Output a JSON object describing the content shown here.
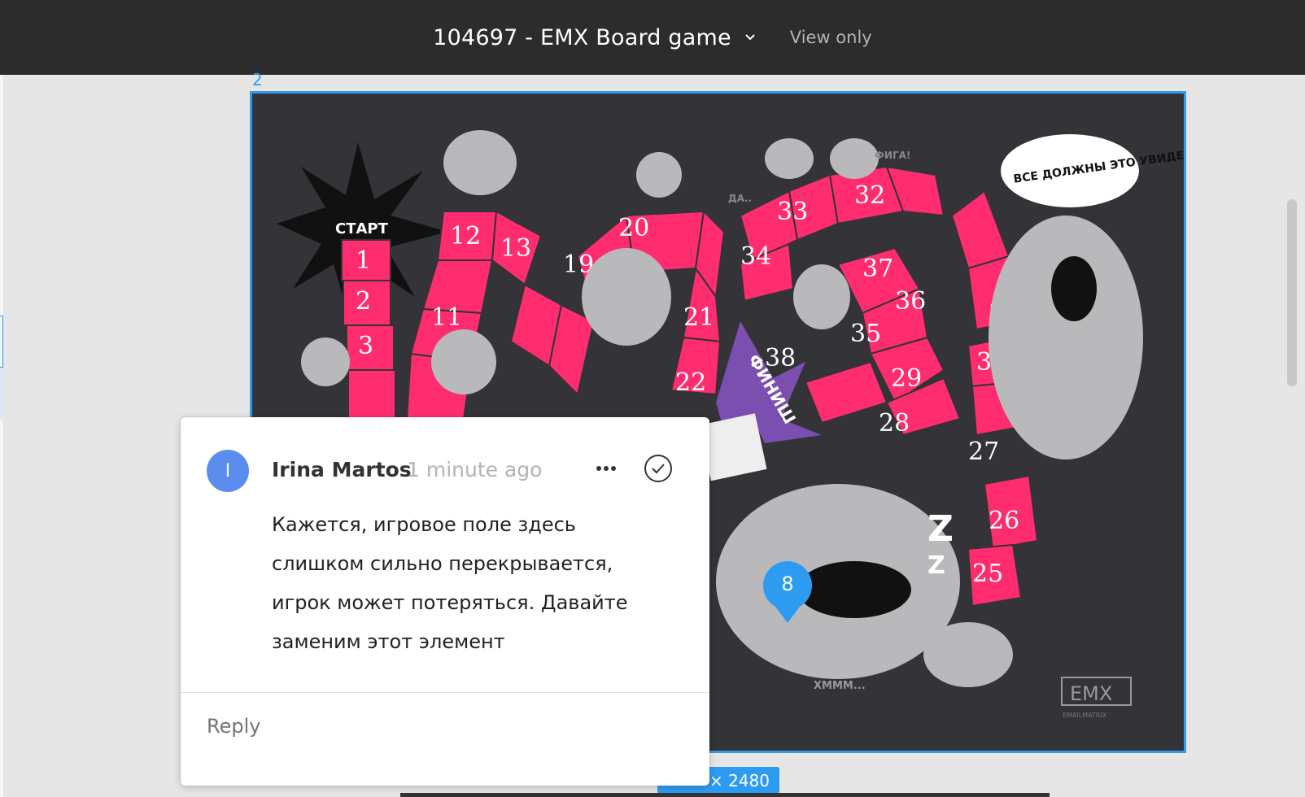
{
  "header": {
    "title": "104697 - EMX Board game",
    "view_mode": "View only"
  },
  "frame": {
    "label": "2",
    "size_label": "× 2480"
  },
  "board": {
    "start_label": "СТАРТ",
    "finish_label": "ФИНИШ",
    "speech_bubble": "ВСЕ ДОЛЖНЫ ЭТО УВИДЕТЬ!",
    "da_label": "ДА..",
    "figa_label": "ФИГА!",
    "hmm_label": "ХМММ...",
    "logo_text": "EMX",
    "logo_sub": "EMAILMATRIX",
    "cells": [
      "1",
      "2",
      "3",
      "11",
      "12",
      "13",
      "19",
      "20",
      "21",
      "22",
      "25",
      "26",
      "27",
      "28",
      "29",
      "30",
      "31",
      "32",
      "33",
      "34",
      "35",
      "36",
      "37",
      "38"
    ]
  },
  "comment": {
    "avatar_initial": "I",
    "author": "Irina Martos",
    "time": "1 minute ago",
    "body": "Кажется, игровое поле здесь слишком сильно перекрывается, игрок может потеряться. Давайте заменим этот элемент",
    "reply_placeholder": "Reply"
  },
  "pin": {
    "number": "8"
  },
  "colors": {
    "accent": "#2d9bf0",
    "board_bg": "#333338",
    "path_pink": "#ff2d6f",
    "avatar": "#5b8def"
  }
}
